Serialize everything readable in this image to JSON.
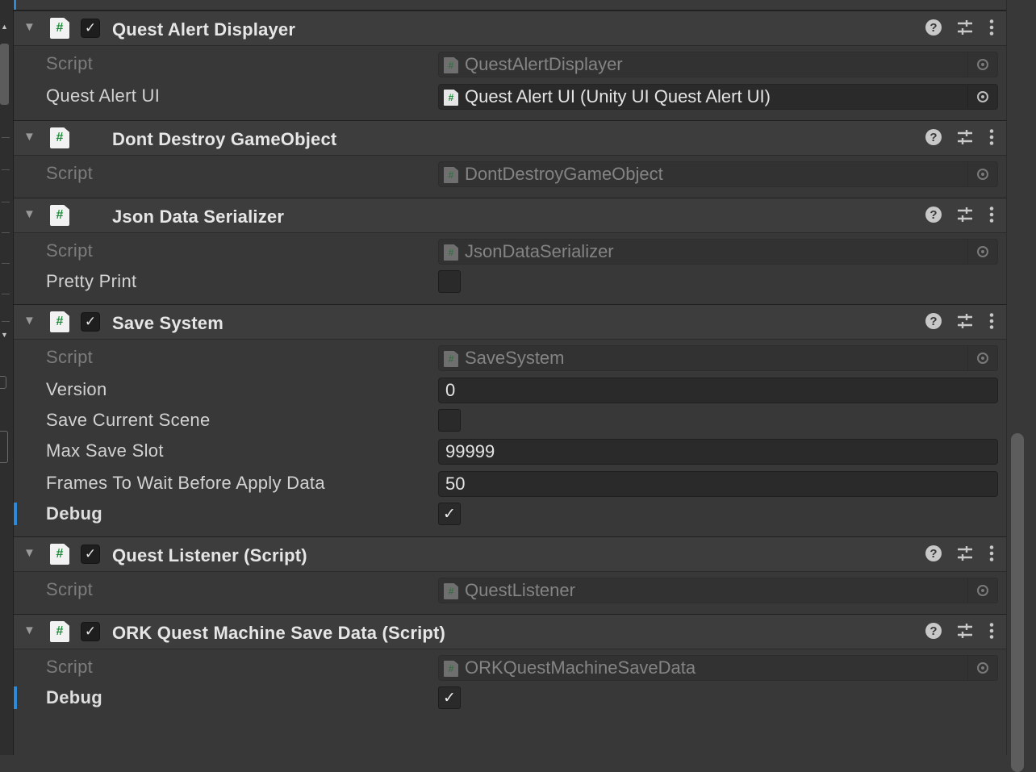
{
  "components": [
    {
      "title": "Quest Alert Displayer",
      "has_toggle": true,
      "enabled": true,
      "fields": [
        {
          "label": "Script",
          "type": "object",
          "value": "QuestAlertDisplayer",
          "disabled": true
        },
        {
          "label": "Quest Alert UI",
          "type": "object",
          "value": "Quest Alert UI (Unity UI Quest Alert UI)",
          "disabled": false
        }
      ]
    },
    {
      "title": "Dont Destroy GameObject",
      "has_toggle": false,
      "fields": [
        {
          "label": "Script",
          "type": "object",
          "value": "DontDestroyGameObject",
          "disabled": true
        }
      ]
    },
    {
      "title": "Json Data Serializer",
      "has_toggle": false,
      "fields": [
        {
          "label": "Script",
          "type": "object",
          "value": "JsonDataSerializer",
          "disabled": true
        },
        {
          "label": "Pretty Print",
          "type": "checkbox",
          "checked": false
        }
      ]
    },
    {
      "title": "Save System",
      "has_toggle": true,
      "enabled": true,
      "fields": [
        {
          "label": "Script",
          "type": "object",
          "value": "SaveSystem",
          "disabled": true
        },
        {
          "label": "Version",
          "type": "text",
          "value": "0"
        },
        {
          "label": "Save Current Scene",
          "type": "checkbox",
          "checked": false
        },
        {
          "label": "Max Save Slot",
          "type": "text",
          "value": "99999"
        },
        {
          "label": "Frames To Wait Before Apply Data",
          "type": "text",
          "value": "50"
        },
        {
          "label": "Debug",
          "type": "checkbox",
          "checked": true,
          "modified": true
        }
      ]
    },
    {
      "title": "Quest Listener (Script)",
      "has_toggle": true,
      "enabled": true,
      "fields": [
        {
          "label": "Script",
          "type": "object",
          "value": "QuestListener",
          "disabled": true
        }
      ]
    },
    {
      "title": "ORK Quest Machine Save Data (Script)",
      "has_toggle": true,
      "enabled": true,
      "fields": [
        {
          "label": "Script",
          "type": "object",
          "value": "ORKQuestMachineSaveData",
          "disabled": true
        },
        {
          "label": "Debug",
          "type": "checkbox",
          "checked": true,
          "modified": true
        }
      ]
    }
  ],
  "glyphs": {
    "foldout": "▼",
    "script_hash": "#",
    "check": "✓",
    "help": "?"
  },
  "icons": [
    "help-icon",
    "presets-icon",
    "more-options-icon",
    "object-picker-icon"
  ],
  "colors": {
    "background": "#383838",
    "header": "#3d3d3d",
    "accent_blue": "#2c8ad8",
    "script_hash_green": "#1d8a3a"
  }
}
